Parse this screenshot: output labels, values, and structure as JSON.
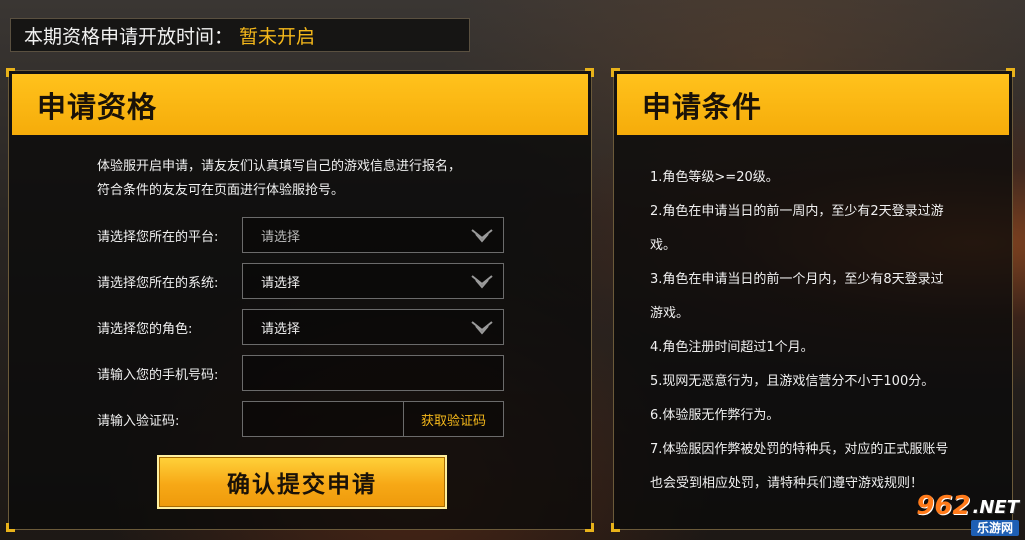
{
  "banner": {
    "label": "本期资格申请开放时间：",
    "value": "暂未开启"
  },
  "left_panel": {
    "title": "申请资格",
    "intro_line1": "体验服开启申请，请友友们认真填写自己的游戏信息进行报名，",
    "intro_line2": "符合条件的友友可在页面进行体验服抢号。",
    "form": {
      "platform_label": "请选择您所在的平台:",
      "platform_value": "请选择",
      "system_label": "请选择您所在的系统:",
      "system_value": "请选择",
      "role_label": "请选择您的角色:",
      "role_value": "请选择",
      "phone_label": "请输入您的手机号码:",
      "phone_value": "",
      "code_label": "请输入验证码:",
      "code_value": "",
      "get_code_button": "获取验证码"
    },
    "submit_label": "确认提交申请"
  },
  "right_panel": {
    "title": "申请条件",
    "conditions": [
      "1.角色等级>=20级。",
      "2.角色在申请当日的前一周内，至少有2天登录过游",
      "戏。",
      "3.角色在申请当日的前一个月内，至少有8天登录过",
      "游戏。",
      "4.角色注册时间超过1个月。",
      "5.现网无恶意行为，且游戏信营分不小于100分。",
      "6.体验服无作弊行为。",
      "7.体验服因作弊被处罚的特种兵，对应的正式服账号",
      "也会受到相应处罚，请特种兵们遵守游戏规则！"
    ]
  },
  "watermark": {
    "number": "962",
    "suffix": ".NET",
    "site_name": "乐游网"
  },
  "colors": {
    "accent_yellow": "#ffc21c",
    "highlight_text": "#f5b81a"
  }
}
